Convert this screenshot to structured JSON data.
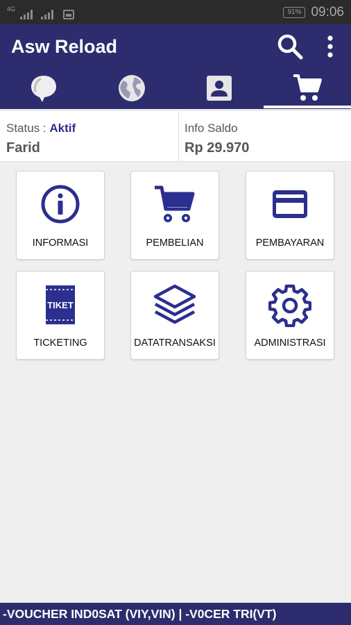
{
  "status_bar": {
    "network_label": "4G",
    "battery": "91%",
    "time": "09:06"
  },
  "app_bar": {
    "title": "Asw Reload",
    "search_icon": "search-icon",
    "more_icon": "more-vert-icon"
  },
  "tabs": [
    {
      "icon": "chat-bubble-icon",
      "active": false
    },
    {
      "icon": "globe-icon",
      "active": false
    },
    {
      "icon": "contact-card-icon",
      "active": false
    },
    {
      "icon": "cart-icon",
      "active": true
    }
  ],
  "info": {
    "status_label": "Status : ",
    "status_value": "Aktif",
    "user_name": "Farid",
    "saldo_label": "Info Saldo",
    "saldo_value": "Rp 29.970"
  },
  "menu": [
    {
      "label": "INFORMASI",
      "icon": "info-icon"
    },
    {
      "label": "PEMBELIAN",
      "icon": "cart-icon"
    },
    {
      "label": "PEMBAYARAN",
      "icon": "credit-card-icon"
    },
    {
      "label": "TICKETING",
      "icon": "ticket-icon",
      "icon_text": "TIKET"
    },
    {
      "label": "DATATRANSAKSI",
      "icon": "layers-icon"
    },
    {
      "label": "ADMINISTRASI",
      "icon": "gear-icon"
    }
  ],
  "ticker": {
    "text": "-VOUCHER IND0SAT (VIY,VIN) | -V0CER TRI(VT)"
  },
  "colors": {
    "primary": "#2c2c6e",
    "icon": "#2b2f8f",
    "background": "#efefef"
  }
}
